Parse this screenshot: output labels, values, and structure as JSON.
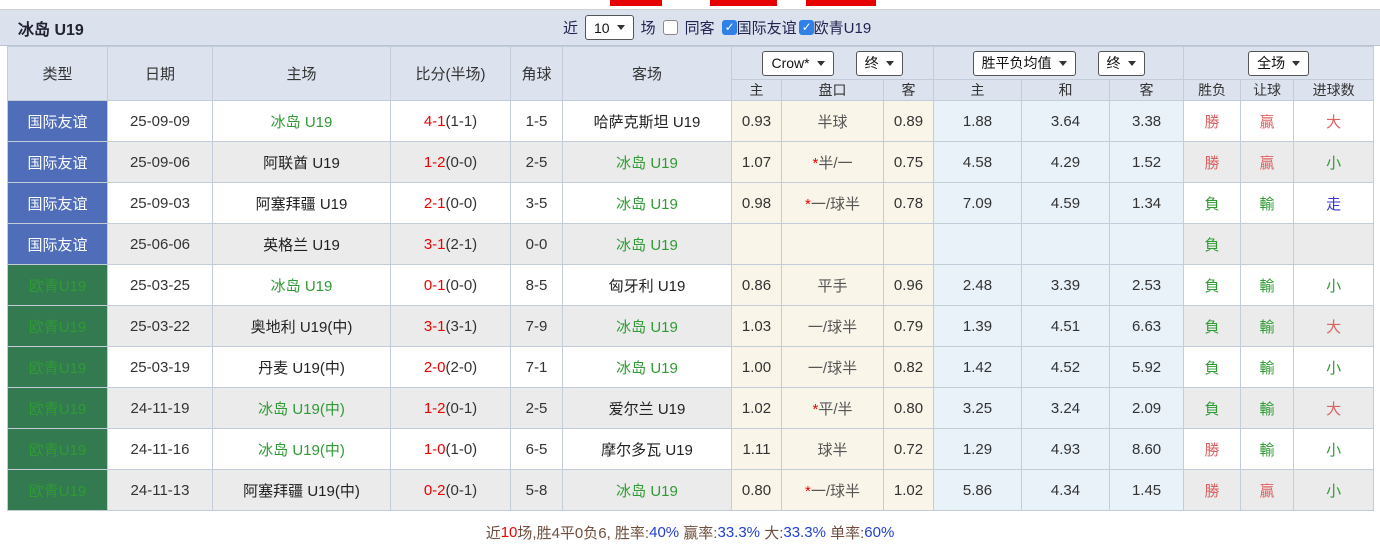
{
  "colors": {
    "accent_red": "#e60000",
    "badge_blue": "#4f6db8",
    "badge_green": "#337a50",
    "team_green": "#2f9b35",
    "score_red": "#ea0000",
    "result_red": "#dd6262",
    "result_green": "#2f9b35",
    "walk_blue": "#3838cf",
    "header_bg": "#dce3ee",
    "crow_bg": "#faf5e9",
    "avg_bg": "#e9f2f9",
    "percent_blue": "#2240d0"
  },
  "titlebar": {
    "title": "冰岛 U19",
    "recent_label": "近",
    "recent_value": "10",
    "matches_label": "场",
    "same_away": {
      "label": "同客",
      "checked": false
    },
    "filter_friendly": {
      "label": "国际友谊",
      "checked": true
    },
    "filter_euro": {
      "label": "欧青U19",
      "checked": true
    }
  },
  "selectors": {
    "odds_source": "Crow*",
    "odds_time": "终",
    "avg_label": "胜平负均值",
    "avg_time": "终",
    "scope": "全场"
  },
  "header": {
    "cols": [
      "类型",
      "日期",
      "主场",
      "比分(半场)",
      "角球",
      "客场"
    ],
    "sub": [
      "主",
      "盘口",
      "客",
      "主",
      "和",
      "客",
      "胜负",
      "让球",
      "进球数"
    ]
  },
  "rows": [
    {
      "type": {
        "t": "国际友谊",
        "c": "blue"
      },
      "date": "25-09-09",
      "home": {
        "t": "冰岛 U19",
        "c": "green"
      },
      "score": {
        "main": "4-1",
        "half": "(1-1)"
      },
      "corner": "1-5",
      "away": {
        "t": "哈萨克斯坦 U19",
        "c": "dark"
      },
      "crow_home": "0.93",
      "handicap": {
        "star": false,
        "t": "半球"
      },
      "crow_away": "0.89",
      "avg_home": "1.88",
      "avg_draw": "3.64",
      "avg_away": "3.38",
      "result": {
        "t": "勝",
        "c": "red"
      },
      "letball": {
        "t": "贏",
        "c": "red"
      },
      "goals": {
        "t": "大",
        "c": "red"
      }
    },
    {
      "type": {
        "t": "国际友谊",
        "c": "blue"
      },
      "date": "25-09-06",
      "home": {
        "t": "阿联酋 U19",
        "c": "dark"
      },
      "score": {
        "main": "1-2",
        "half": "(0-0)"
      },
      "corner": "2-5",
      "away": {
        "t": "冰岛 U19",
        "c": "green"
      },
      "crow_home": "1.07",
      "handicap": {
        "star": true,
        "t": "半/一"
      },
      "crow_away": "0.75",
      "avg_home": "4.58",
      "avg_draw": "4.29",
      "avg_away": "1.52",
      "result": {
        "t": "勝",
        "c": "red"
      },
      "letball": {
        "t": "贏",
        "c": "red"
      },
      "goals": {
        "t": "小",
        "c": "green"
      }
    },
    {
      "type": {
        "t": "国际友谊",
        "c": "blue"
      },
      "date": "25-09-03",
      "home": {
        "t": "阿塞拜疆 U19",
        "c": "dark"
      },
      "score": {
        "main": "2-1",
        "half": "(0-0)"
      },
      "corner": "3-5",
      "away": {
        "t": "冰岛 U19",
        "c": "green"
      },
      "crow_home": "0.98",
      "handicap": {
        "star": true,
        "t": "一/球半"
      },
      "crow_away": "0.78",
      "avg_home": "7.09",
      "avg_draw": "4.59",
      "avg_away": "1.34",
      "result": {
        "t": "負",
        "c": "green"
      },
      "letball": {
        "t": "輸",
        "c": "green"
      },
      "goals": {
        "t": "走",
        "c": "blue2"
      }
    },
    {
      "type": {
        "t": "国际友谊",
        "c": "blue"
      },
      "date": "25-06-06",
      "home": {
        "t": "英格兰 U19",
        "c": "dark"
      },
      "score": {
        "main": "3-1",
        "half": "(2-1)"
      },
      "corner": "0-0",
      "away": {
        "t": "冰岛 U19",
        "c": "green"
      },
      "crow_home": "",
      "handicap": {
        "star": false,
        "t": ""
      },
      "crow_away": "",
      "avg_home": "",
      "avg_draw": "",
      "avg_away": "",
      "result": {
        "t": "負",
        "c": "green"
      },
      "letball": {
        "t": "",
        "c": "green"
      },
      "goals": {
        "t": "",
        "c": "green"
      }
    },
    {
      "type": {
        "t": "欧青U19",
        "c": "green"
      },
      "date": "25-03-25",
      "home": {
        "t": "冰岛 U19",
        "c": "green"
      },
      "score": {
        "main": "0-1",
        "half": "(0-0)"
      },
      "corner": "8-5",
      "away": {
        "t": "匈牙利 U19",
        "c": "dark"
      },
      "crow_home": "0.86",
      "handicap": {
        "star": false,
        "t": "平手"
      },
      "crow_away": "0.96",
      "avg_home": "2.48",
      "avg_draw": "3.39",
      "avg_away": "2.53",
      "result": {
        "t": "負",
        "c": "green"
      },
      "letball": {
        "t": "輸",
        "c": "green"
      },
      "goals": {
        "t": "小",
        "c": "green"
      }
    },
    {
      "type": {
        "t": "欧青U19",
        "c": "green"
      },
      "date": "25-03-22",
      "home": {
        "t": "奥地利 U19(中)",
        "c": "dark"
      },
      "score": {
        "main": "3-1",
        "half": "(3-1)"
      },
      "corner": "7-9",
      "away": {
        "t": "冰岛 U19",
        "c": "green"
      },
      "crow_home": "1.03",
      "handicap": {
        "star": false,
        "t": "一/球半"
      },
      "crow_away": "0.79",
      "avg_home": "1.39",
      "avg_draw": "4.51",
      "avg_away": "6.63",
      "result": {
        "t": "負",
        "c": "green"
      },
      "letball": {
        "t": "輸",
        "c": "green"
      },
      "goals": {
        "t": "大",
        "c": "red"
      }
    },
    {
      "type": {
        "t": "欧青U19",
        "c": "green"
      },
      "date": "25-03-19",
      "home": {
        "t": "丹麦 U19(中)",
        "c": "dark"
      },
      "score": {
        "main": "2-0",
        "half": "(2-0)"
      },
      "corner": "7-1",
      "away": {
        "t": "冰岛 U19",
        "c": "green"
      },
      "crow_home": "1.00",
      "handicap": {
        "star": false,
        "t": "一/球半"
      },
      "crow_away": "0.82",
      "avg_home": "1.42",
      "avg_draw": "4.52",
      "avg_away": "5.92",
      "result": {
        "t": "負",
        "c": "green"
      },
      "letball": {
        "t": "輸",
        "c": "green"
      },
      "goals": {
        "t": "小",
        "c": "green"
      }
    },
    {
      "type": {
        "t": "欧青U19",
        "c": "green"
      },
      "date": "24-11-19",
      "home": {
        "t": "冰岛 U19(中)",
        "c": "green"
      },
      "score": {
        "main": "1-2",
        "half": "(0-1)"
      },
      "corner": "2-5",
      "away": {
        "t": "爱尔兰 U19",
        "c": "dark"
      },
      "crow_home": "1.02",
      "handicap": {
        "star": true,
        "t": "平/半"
      },
      "crow_away": "0.80",
      "avg_home": "3.25",
      "avg_draw": "3.24",
      "avg_away": "2.09",
      "result": {
        "t": "負",
        "c": "green"
      },
      "letball": {
        "t": "輸",
        "c": "green"
      },
      "goals": {
        "t": "大",
        "c": "red"
      }
    },
    {
      "type": {
        "t": "欧青U19",
        "c": "green"
      },
      "date": "24-11-16",
      "home": {
        "t": "冰岛 U19(中)",
        "c": "green"
      },
      "score": {
        "main": "1-0",
        "half": "(1-0)"
      },
      "corner": "6-5",
      "away": {
        "t": "摩尔多瓦 U19",
        "c": "dark"
      },
      "crow_home": "1.11",
      "handicap": {
        "star": false,
        "t": "球半"
      },
      "crow_away": "0.72",
      "avg_home": "1.29",
      "avg_draw": "4.93",
      "avg_away": "8.60",
      "result": {
        "t": "勝",
        "c": "red"
      },
      "letball": {
        "t": "輸",
        "c": "green"
      },
      "goals": {
        "t": "小",
        "c": "green"
      }
    },
    {
      "type": {
        "t": "欧青U19",
        "c": "green"
      },
      "date": "24-11-13",
      "home": {
        "t": "阿塞拜疆 U19(中)",
        "c": "dark"
      },
      "score": {
        "main": "0-2",
        "half": "(0-1)"
      },
      "corner": "5-8",
      "away": {
        "t": "冰岛 U19",
        "c": "green"
      },
      "crow_home": "0.80",
      "handicap": {
        "star": true,
        "t": "一/球半"
      },
      "crow_away": "1.02",
      "avg_home": "5.86",
      "avg_draw": "4.34",
      "avg_away": "1.45",
      "result": {
        "t": "勝",
        "c": "red"
      },
      "letball": {
        "t": "贏",
        "c": "red"
      },
      "goals": {
        "t": "小",
        "c": "green"
      }
    }
  ],
  "footer": {
    "segments": [
      {
        "t": "近",
        "c": "brown"
      },
      {
        "t": "10",
        "c": "bred"
      },
      {
        "t": "场,胜4平0负6, 胜率:",
        "c": "brown"
      },
      {
        "t": "40%",
        "c": "blue"
      },
      {
        "t": " 赢率:",
        "c": "brown"
      },
      {
        "t": "33.3%",
        "c": "blue"
      },
      {
        "t": " 大:",
        "c": "brown"
      },
      {
        "t": "33.3%",
        "c": "blue"
      },
      {
        "t": " 单率:",
        "c": "brown"
      },
      {
        "t": "60%",
        "c": "blue"
      }
    ]
  }
}
